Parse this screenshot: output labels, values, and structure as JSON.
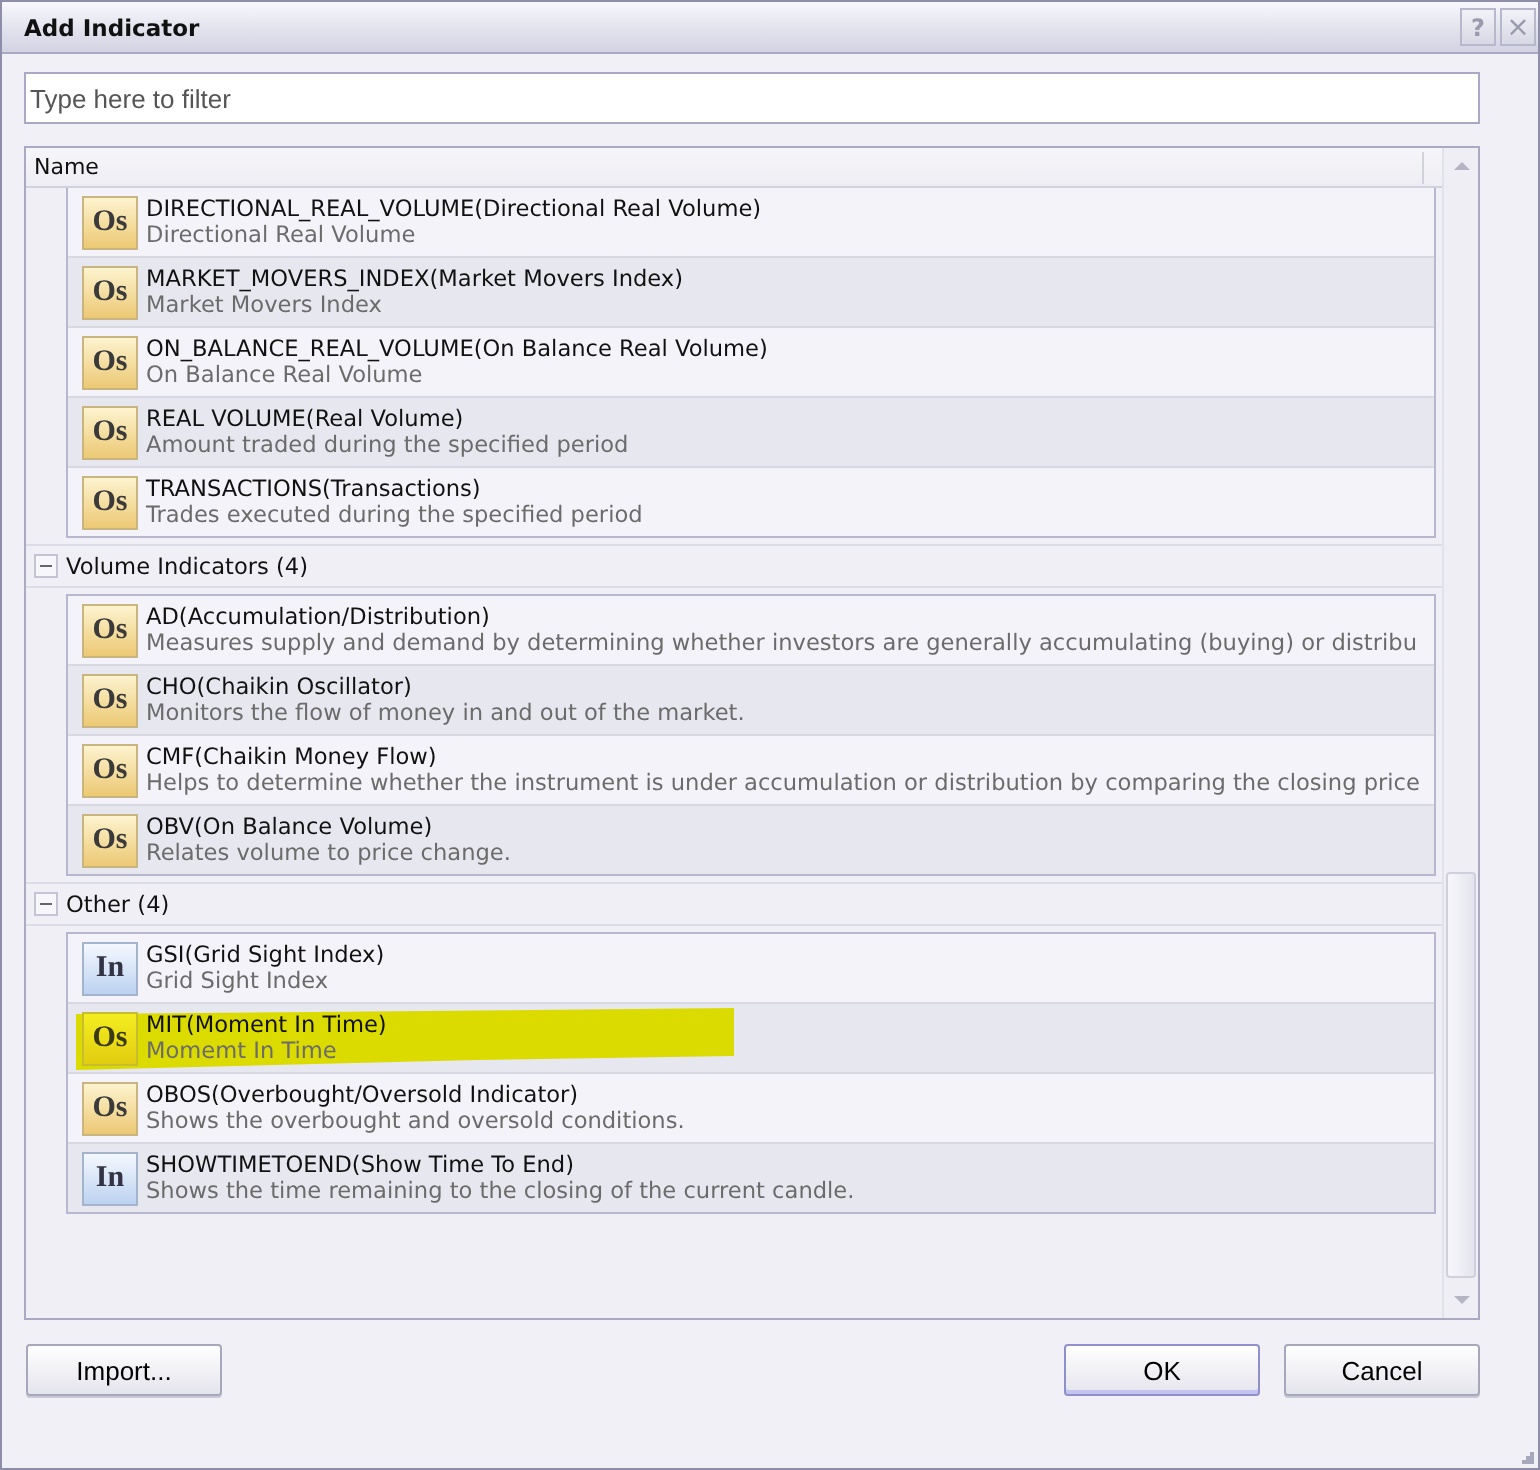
{
  "window": {
    "title": "Add Indicator",
    "title_buttons": [
      {
        "kind": "help",
        "label": "?"
      },
      {
        "kind": "close",
        "label": "×"
      }
    ]
  },
  "filter": {
    "placeholder": "Type here to filter"
  },
  "list": {
    "column": "Name",
    "groups": [
      {
        "rows": [
          {
            "name": "DIRECTIONAL_REAL_VOLUME(Directional Real Volume)",
            "description": "Directional Real Volume",
            "badge": "Os",
            "kind": "oscillator",
            "highlighted": false
          },
          {
            "name": "MARKET_MOVERS_INDEX(Market Movers Index)",
            "description": "Market Movers Index",
            "badge": "Os",
            "kind": "oscillator",
            "highlighted": false
          },
          {
            "name": "ON_BALANCE_REAL_VOLUME(On Balance Real Volume)",
            "description": "On Balance Real Volume",
            "badge": "Os",
            "kind": "oscillator",
            "highlighted": false
          },
          {
            "name": "REAL VOLUME(Real Volume)",
            "description": "Amount traded during the specified period",
            "badge": "Os",
            "kind": "oscillator",
            "highlighted": false
          },
          {
            "name": "TRANSACTIONS(Transactions)",
            "description": "Trades executed during the specified period",
            "badge": "Os",
            "kind": "oscillator",
            "highlighted": false
          }
        ]
      },
      {
        "label": "Volume Indicators (4)",
        "expanded": true,
        "rows": [
          {
            "name": "AD(Accumulation/Distribution)",
            "description": "Measures supply and demand by determining whether investors are generally accumulating (buying) or distribu",
            "badge": "Os",
            "kind": "oscillator",
            "highlighted": false
          },
          {
            "name": "CHO(Chaikin Oscillator)",
            "description": "Monitors the flow of money in and out of the market.",
            "badge": "Os",
            "kind": "oscillator",
            "highlighted": false
          },
          {
            "name": "CMF(Chaikin Money Flow)",
            "description": "Helps to determine whether the instrument is under accumulation or distribution by comparing the closing price",
            "badge": "Os",
            "kind": "oscillator",
            "highlighted": false
          },
          {
            "name": "OBV(On Balance Volume)",
            "description": "Relates volume to price change.",
            "badge": "Os",
            "kind": "oscillator",
            "highlighted": false
          }
        ]
      },
      {
        "label": "Other (4)",
        "expanded": true,
        "rows": [
          {
            "name": "GSI(Grid Sight Index)",
            "description": "Grid Sight Index",
            "badge": "In",
            "kind": "indicator",
            "highlighted": false
          },
          {
            "name": "MIT(Moment In Time)",
            "description": "Momemt In Time",
            "badge": "Os",
            "kind": "oscillator",
            "highlighted": true
          },
          {
            "name": "OBOS(Overbought/Oversold Indicator)",
            "description": "Shows the overbought and oversold conditions.",
            "badge": "Os",
            "kind": "oscillator",
            "highlighted": false
          },
          {
            "name": "SHOWTIMETOEND(Show Time To End)",
            "description": "Shows the time remaining to the closing of the current candle.",
            "badge": "In",
            "kind": "indicator",
            "highlighted": false
          }
        ]
      }
    ]
  },
  "footer": {
    "left_buttons": [
      {
        "label": "Import...",
        "default": false
      }
    ],
    "right_buttons": [
      {
        "label": "OK",
        "default": true
      },
      {
        "label": "Cancel",
        "default": false
      }
    ]
  }
}
